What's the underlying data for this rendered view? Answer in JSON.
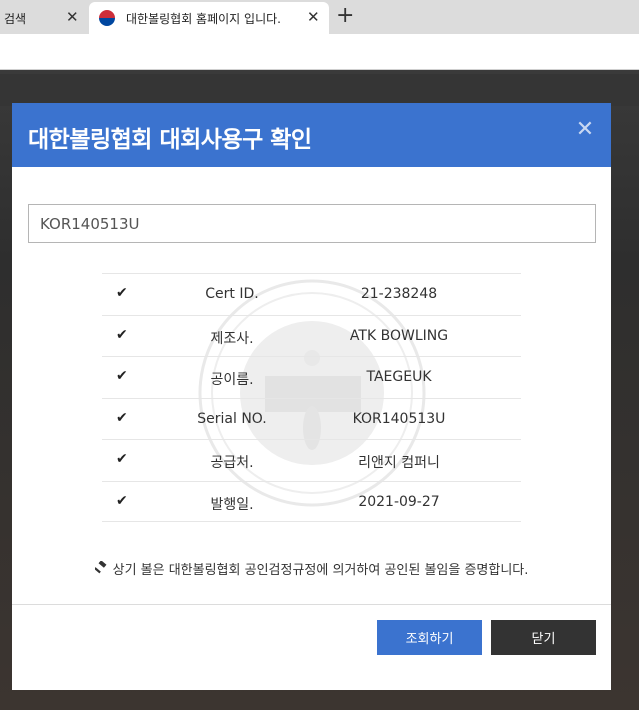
{
  "browser": {
    "tabs": [
      {
        "label": "검색",
        "active": false
      },
      {
        "label": "대한볼링협회 홈페이지 입니다.",
        "active": true
      }
    ],
    "new_tab_icon": "plus-icon",
    "close_icon": "close-icon"
  },
  "modal": {
    "title": "대한볼링협회 대회사용구 확인",
    "serial_value": "KOR140513U",
    "rows": [
      {
        "label": "Cert ID.",
        "value": "21-238248"
      },
      {
        "label": "제조사.",
        "value": "ATK BOWLING"
      },
      {
        "label": "공이름.",
        "value": "TAEGEUK"
      },
      {
        "label": "Serial NO.",
        "value": "KOR140513U"
      },
      {
        "label": "공급처.",
        "value": "리앤지 컴퍼니"
      },
      {
        "label": "발행일.",
        "value": "2021-09-27"
      }
    ],
    "check_mark": "✔",
    "notice": "상기 볼은 대한볼링협회 공인검정규정에 의거하여 공인된 볼임을 증명합니다.",
    "buttons": {
      "lookup": "조회하기",
      "close": "닫기"
    }
  },
  "colors": {
    "header_blue": "#3b73cf",
    "dark_button": "#333333"
  }
}
